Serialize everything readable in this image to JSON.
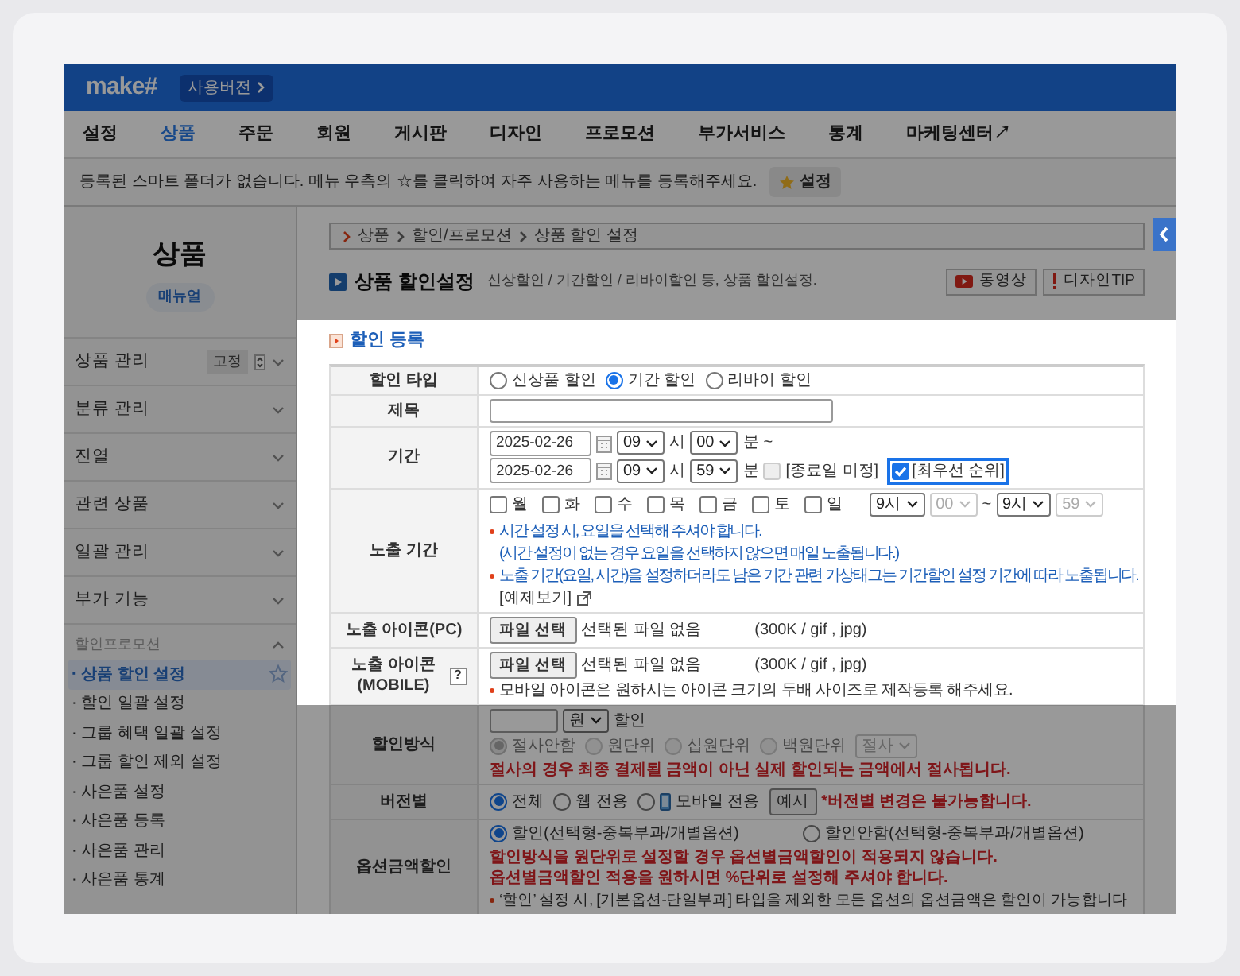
{
  "header": {
    "logo": "make#",
    "version_button": "사용버전"
  },
  "nav": [
    {
      "label": "설정",
      "selected": false
    },
    {
      "label": "상품",
      "selected": true
    },
    {
      "label": "주문",
      "selected": false
    },
    {
      "label": "회원",
      "selected": false
    },
    {
      "label": "게시판",
      "selected": false
    },
    {
      "label": "디자인",
      "selected": false
    },
    {
      "label": "프로모션",
      "selected": false
    },
    {
      "label": "부가서비스",
      "selected": false
    },
    {
      "label": "통계",
      "selected": false
    },
    {
      "label": "마케팅센터↗",
      "selected": false
    }
  ],
  "smart_folder": {
    "message": "등록된 스마트 폴더가 없습니다. 메뉴 우측의 ☆를 클릭하여 자주 사용하는 메뉴를 등록해주세요.",
    "button": "설정"
  },
  "sidebar": {
    "title": "상품",
    "manual_button": "매뉴얼",
    "sections": [
      {
        "label": "상품 관리",
        "expanded": false,
        "pin_button": "고정"
      },
      {
        "label": "분류 관리",
        "expanded": false
      },
      {
        "label": "진열",
        "expanded": false
      },
      {
        "label": "관련 상품",
        "expanded": false
      },
      {
        "label": "일괄 관리",
        "expanded": false
      },
      {
        "label": "부가 기능",
        "expanded": false
      },
      {
        "label": "할인프로모션",
        "expanded": true,
        "children": [
          {
            "label": "· 상품 할인 설정",
            "selected": true
          },
          {
            "label": "· 할인 일괄 설정",
            "selected": false
          },
          {
            "label": "· 그룹 혜택 일괄 설정",
            "selected": false
          },
          {
            "label": "· 그룹 할인 제외 설정",
            "selected": false
          },
          {
            "label": "· 사은품 설정",
            "selected": false
          },
          {
            "label": "· 사은품 등록",
            "selected": false
          },
          {
            "label": "· 사은품 관리",
            "selected": false
          },
          {
            "label": "· 사은품 통계",
            "selected": false
          }
        ]
      }
    ]
  },
  "breadcrumb": [
    "상품",
    "할인/프로모션",
    "상품 할인 설정"
  ],
  "page_title": "상품 할인설정",
  "page_description": "신상할인 / 기간할인 / 리바이할인 등, 상품 할인설정.",
  "page_buttons": [
    {
      "kind": "video",
      "label": "동영상"
    },
    {
      "kind": "tip",
      "label": "디자인TIP"
    }
  ],
  "section_title": "할인 등록",
  "rows": [
    {
      "kind": "radio",
      "highlighted": true,
      "label": "할인 타입",
      "options": [
        {
          "label": "신상품 할인",
          "selected": false
        },
        {
          "label": "기간 할인",
          "selected": true
        },
        {
          "label": "리바이 할인",
          "selected": false
        }
      ]
    },
    {
      "kind": "text",
      "highlighted": true,
      "label": "제목"
    },
    {
      "kind": "period",
      "highlighted": true,
      "label": "기간",
      "ranges": [
        {
          "date": "2025-02-26",
          "hour": "09",
          "hour_unit": "시",
          "minute": "00",
          "minute_unit": "분"
        },
        {
          "date": "2025-02-26",
          "hour": "09",
          "hour_unit": "시",
          "minute": "59",
          "minute_unit": "분"
        }
      ],
      "tilde": "~",
      "no_end": {
        "label": "[종료일 미정]",
        "checked": false,
        "disabled": true
      },
      "top_priority": {
        "label": "[최우선 순위]",
        "checked": true
      }
    },
    {
      "kind": "exposure",
      "highlighted": true,
      "label": "노출 기간",
      "days": [
        {
          "label": "월",
          "checked": false
        },
        {
          "label": "화",
          "checked": false
        },
        {
          "label": "수",
          "checked": false
        },
        {
          "label": "목",
          "checked": false
        },
        {
          "label": "금",
          "checked": false
        },
        {
          "label": "토",
          "checked": false
        },
        {
          "label": "일",
          "checked": false
        }
      ],
      "times": [
        {
          "value": "9시",
          "disabled": false
        },
        {
          "value": "00",
          "disabled": true
        },
        {
          "value": "9시",
          "disabled": false
        },
        {
          "value": "59",
          "disabled": true
        }
      ],
      "tilde": "~",
      "notes": [
        {
          "text": "시간 설정 시, 요일을 선택해 주셔야 합니다.",
          "bullet": true
        },
        {
          "text": "(시간 설정이 없는 경우 요일을 선택하지 않으면 매일 노출됩니다.)",
          "bullet": false
        },
        {
          "text": "노출 기간(요일, 시간)을 설정하더라도 남은 기간 관련 가상태그는 기간할인 설정 기간에 따라 노출됩니다.",
          "bullet": true
        }
      ],
      "example_link": "[예제보기]"
    },
    {
      "kind": "file",
      "highlighted": true,
      "label": "노출 아이콘(PC)",
      "button": "파일 선택",
      "status": "선택된 파일 없음",
      "hint": "(300K / gif , jpg)"
    },
    {
      "kind": "file",
      "highlighted": true,
      "label": "노출 아이콘(MOBILE)",
      "help": "?",
      "button": "파일 선택",
      "status": "선택된 파일 없음",
      "hint": "(300K / gif , jpg)",
      "note": "모바일 아이콘은 원하시는 아이콘 크기의 두배 사이즈로 제작등록 해주세요."
    },
    {
      "kind": "discount_method",
      "highlighted": false,
      "label": "할인방식",
      "unit": "원",
      "suffix": "할인",
      "rounding": [
        {
          "label": "절사안함",
          "selected": true
        },
        {
          "label": "원단위",
          "selected": false
        },
        {
          "label": "십원단위",
          "selected": false
        },
        {
          "label": "백원단위",
          "selected": false
        }
      ],
      "rounding_select": "절사",
      "warning": "절사의 경우 최종 결제될 금액이 아닌 실제 할인되는 금액에서 절사됩니다."
    },
    {
      "kind": "version",
      "highlighted": false,
      "label": "버전별",
      "options": [
        {
          "kind": "plain",
          "label": "전체",
          "selected": true
        },
        {
          "kind": "plain",
          "label": "웹 전용",
          "selected": false
        },
        {
          "kind": "device",
          "label": "모바일 전용",
          "selected": false
        }
      ],
      "example_button": "예시",
      "warning": "*버전별 변경은 불가능합니다."
    },
    {
      "kind": "option_discount",
      "highlighted": false,
      "label": "옵션금액할인",
      "options": [
        {
          "label": "할인(선택형-중복부과/개별옵션)",
          "selected": true
        },
        {
          "label": "할인안함(선택형-중복부과/개별옵션)",
          "selected": false
        }
      ],
      "warnings": [
        "할인방식을 원단위로 설정할 경우 옵션별금액할인이 적용되지 않습니다.",
        "옵션별금액할인 적용을 원하시면 %단위로 설정해 주셔야 합니다."
      ],
      "note": "‘할인’ 설정 시, [기본옵션-단일부과] 타입을 제외한 모든 옵션의 옵션금액은 할인이 가능합니다"
    }
  ]
}
